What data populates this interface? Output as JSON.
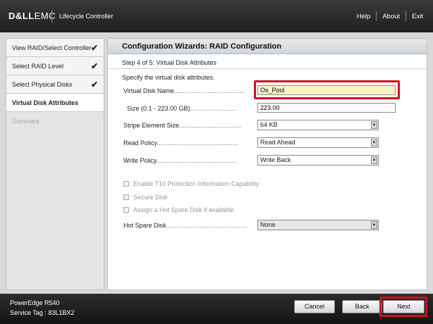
{
  "header": {
    "logo_dell": "D&LL",
    "logo_emc": "EMC",
    "product": "Lifecycle Controller",
    "nav": {
      "help": "Help",
      "about": "About",
      "exit": "Exit"
    }
  },
  "sidebar": {
    "items": [
      {
        "label": "View RAID/Select Controller",
        "check": "✔"
      },
      {
        "label": "Select RAID Level",
        "check": "✔"
      },
      {
        "label": "Select Physical Disks",
        "check": "✔"
      },
      {
        "label": "Virtual Disk Attributes"
      },
      {
        "label": "Summary"
      }
    ]
  },
  "main": {
    "title": "Configuration Wizards: RAID Configuration",
    "step": "Step 4 of 5: Virtual Disk Attributes",
    "instructions": "Specify the virtual disk attributes.",
    "fields": {
      "vd_name": {
        "label": "Virtual Disk Name",
        "value": "Os_Pool"
      },
      "size": {
        "label": "Size (0.1 - 223.00 GB)",
        "value": "223.00"
      },
      "stripe": {
        "label": "Stripe Element Size",
        "value": "64 KB"
      },
      "read_policy": {
        "label": "Read Policy",
        "value": "Read Ahead"
      },
      "write_policy": {
        "label": "Write Policy",
        "value": "Write Back"
      },
      "hot_spare": {
        "label": "Hot Spare Disk",
        "value": "None"
      }
    },
    "checkboxes": {
      "t10": "Enable T10 Protection Information Capability",
      "secure": "Secure Disk",
      "hot_spare": "Assign a Hot Spare Disk if available"
    }
  },
  "footer": {
    "model": "PowerEdge R540",
    "service_tag": "Service Tag : 83L1BX2",
    "buttons": {
      "cancel": "Cancel",
      "back": "Back",
      "next": "Next"
    }
  },
  "icons": {
    "check": "check-icon",
    "dropdown": "chevron-down-icon"
  },
  "colors": {
    "highlight": "#d0101a",
    "focus_bg": "#fbf3c8",
    "header_bg": "#2a2a2a"
  }
}
